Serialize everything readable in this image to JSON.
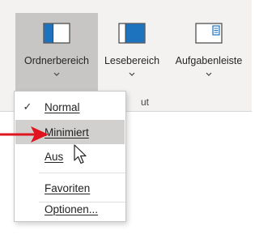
{
  "ribbon": {
    "buttons": [
      {
        "label": "Ordnerbereich",
        "icon": "folder-pane-icon",
        "state": "pressed"
      },
      {
        "label": "Lesebereich",
        "icon": "reading-pane-icon"
      },
      {
        "label": "Aufgabenleiste",
        "icon": "todo-bar-icon"
      }
    ],
    "group_label_partial": "ut"
  },
  "menu": {
    "items": [
      {
        "label": "Normal",
        "checked": true,
        "accelerator": "N"
      },
      {
        "label": "Minimiert",
        "checked": false,
        "hover": true,
        "accelerator": "M"
      },
      {
        "label": "Aus",
        "checked": false,
        "accelerator": "A"
      },
      {
        "label": "Favoriten",
        "checked": false,
        "accelerator": "F"
      },
      {
        "label": "Optionen...",
        "checked": false,
        "accelerator": "p"
      }
    ],
    "check_glyph": "✓"
  },
  "colors": {
    "pressed_button": "#c8c6c4",
    "hover_item": "#d2d0ce",
    "annotation_arrow": "#e0141e",
    "icon_blue": "#1e73be"
  }
}
